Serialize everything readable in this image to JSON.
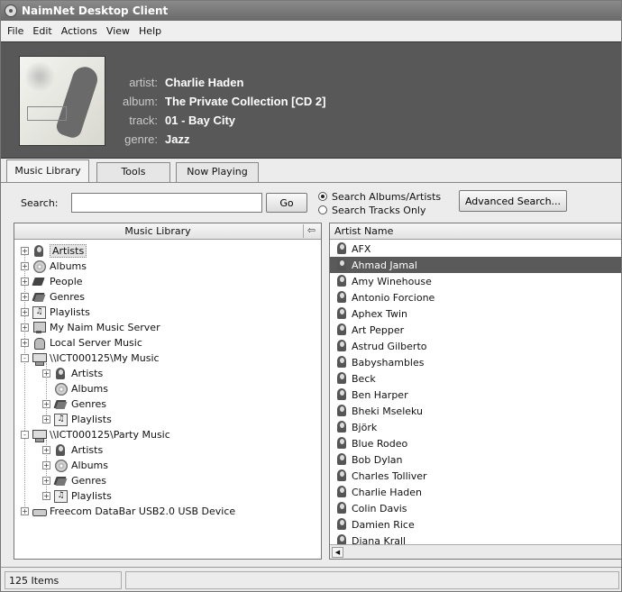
{
  "window": {
    "title": "NaimNet Desktop Client"
  },
  "menu": [
    "File",
    "Edit",
    "Actions",
    "View",
    "Help"
  ],
  "now_playing": {
    "labels": {
      "artist": "artist:",
      "album": "album:",
      "track": "track:",
      "genre": "genre:"
    },
    "artist": "Charlie Haden",
    "album": "The Private Collection [CD 2]",
    "track": "01 - Bay City",
    "genre": "Jazz"
  },
  "tabs": [
    {
      "label": "Music Library",
      "active": true
    },
    {
      "label": "Tools",
      "active": false
    },
    {
      "label": "Now Playing",
      "active": false
    }
  ],
  "search": {
    "label": "Search:",
    "value": "",
    "go_label": "Go",
    "option_albums": "Search Albums/Artists",
    "option_tracks": "Search Tracks Only",
    "selected_option": "albums_artists",
    "advanced_label": "Advanced Search..."
  },
  "library": {
    "title": "Music Library",
    "pin_icon": "pin-icon",
    "tree": [
      {
        "label": "Artists",
        "icon": "artist-icon",
        "expander": "+",
        "selected": true
      },
      {
        "label": "Albums",
        "icon": "album-icon",
        "expander": "+"
      },
      {
        "label": "People",
        "icon": "people-icon",
        "expander": "+"
      },
      {
        "label": "Genres",
        "icon": "genre-icon",
        "expander": "+"
      },
      {
        "label": "Playlists",
        "icon": "playlist-icon",
        "expander": "+"
      },
      {
        "label": "My Naim Music Server",
        "icon": "server-icon",
        "expander": "+"
      },
      {
        "label": "Local Server Music",
        "icon": "local-music-icon",
        "expander": "+"
      },
      {
        "label": "\\\\ICT000125\\My Music",
        "icon": "network-drive-icon",
        "expander": "-"
      },
      {
        "label": "Artists",
        "icon": "artist-icon",
        "expander": "+"
      },
      {
        "label": "Albums",
        "icon": "album-icon",
        "expander": ""
      },
      {
        "label": "Genres",
        "icon": "genre-icon",
        "expander": "+"
      },
      {
        "label": "Playlists",
        "icon": "playlist-icon",
        "expander": "+"
      },
      {
        "label": "\\\\ICT000125\\Party Music",
        "icon": "network-drive-icon",
        "expander": "-"
      },
      {
        "label": "Artists",
        "icon": "artist-icon",
        "expander": "+"
      },
      {
        "label": "Albums",
        "icon": "album-icon",
        "expander": "+"
      },
      {
        "label": "Genres",
        "icon": "genre-icon",
        "expander": "+"
      },
      {
        "label": "Playlists",
        "icon": "playlist-icon",
        "expander": "+"
      },
      {
        "label": "Freecom DataBar USB2.0 USB Device",
        "icon": "usb-drive-icon",
        "expander": "+"
      }
    ]
  },
  "artists": {
    "header": "Artist Name",
    "selected": "Ahmad Jamal",
    "items": [
      "AFX",
      "Ahmad Jamal",
      "Amy Winehouse",
      "Antonio Forcione",
      "Aphex Twin",
      "Art Pepper",
      "Astrud Gilberto",
      "Babyshambles",
      "Beck",
      "Ben Harper",
      "Bheki Mseleku",
      "Björk",
      "Blue Rodeo",
      "Bob Dylan",
      "Charles Tolliver",
      "Charlie Haden",
      "Colin Davis",
      "Damien Rice",
      "Diana Krall"
    ]
  },
  "status": {
    "items": "125 Items"
  }
}
